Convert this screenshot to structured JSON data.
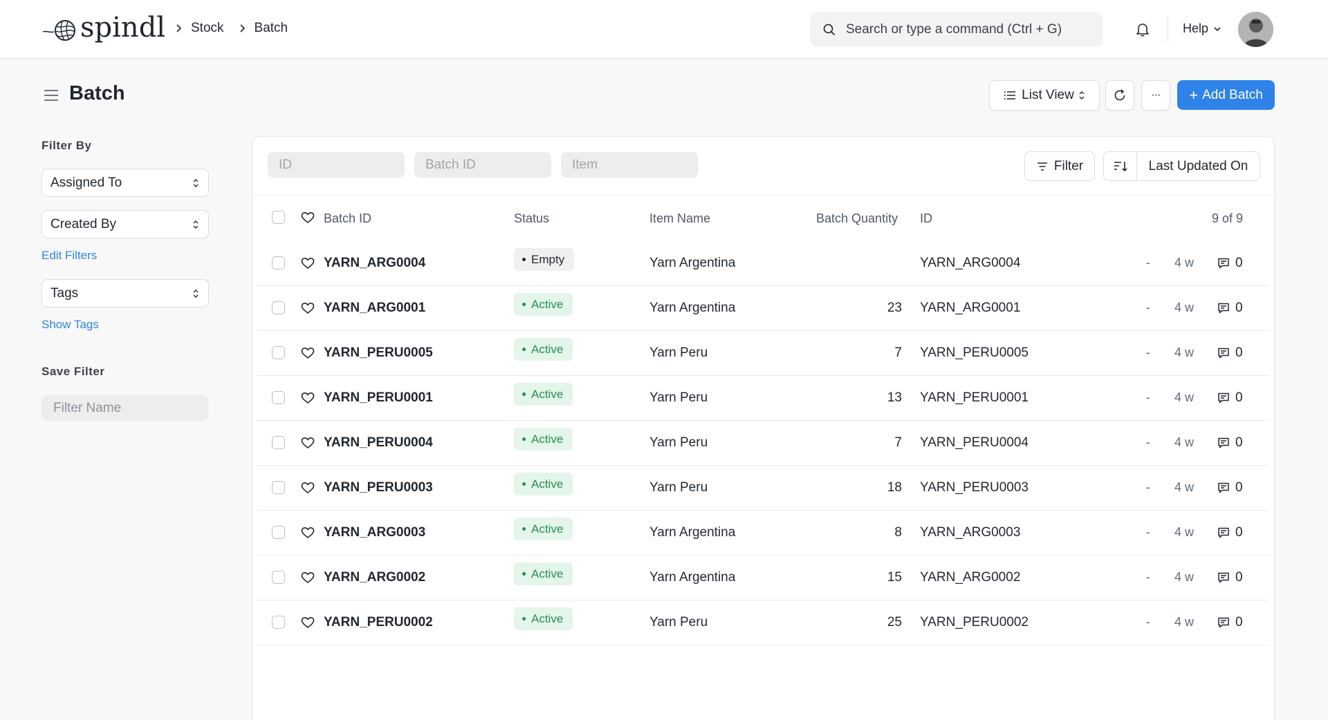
{
  "brand": {
    "name": "spindl"
  },
  "breadcrumbs": [
    "Stock",
    "Batch"
  ],
  "search": {
    "placeholder": "Search or type a command (Ctrl + G)"
  },
  "navbar": {
    "help_label": "Help"
  },
  "page": {
    "title": "Batch",
    "view_label": "List View",
    "add_label": "Add Batch",
    "more_label": "···"
  },
  "sidebar": {
    "filter_heading": "Filter By",
    "assigned_to": "Assigned To",
    "created_by": "Created By",
    "edit_filters": "Edit Filters",
    "tags": "Tags",
    "show_tags": "Show Tags",
    "save_filter_heading": "Save Filter",
    "filter_name_placeholder": "Filter Name"
  },
  "list": {
    "filters": {
      "id_placeholder": "ID",
      "batch_id_placeholder": "Batch ID",
      "item_placeholder": "Item"
    },
    "filter_label": "Filter",
    "sort_label": "Last Updated On",
    "columns": {
      "batch_id": "Batch ID",
      "status": "Status",
      "item_name": "Item Name",
      "batch_qty": "Batch Quantity",
      "id": "ID"
    },
    "count": "9 of 9",
    "rows": [
      {
        "batch_id": "YARN_ARG0004",
        "status": "Empty",
        "item_name": "Yarn Argentina",
        "qty": "",
        "id": "YARN_ARG0004",
        "dash": "-",
        "modified": "4 w",
        "comments": "0"
      },
      {
        "batch_id": "YARN_ARG0001",
        "status": "Active",
        "item_name": "Yarn Argentina",
        "qty": "23",
        "id": "YARN_ARG0001",
        "dash": "-",
        "modified": "4 w",
        "comments": "0"
      },
      {
        "batch_id": "YARN_PERU0005",
        "status": "Active",
        "item_name": "Yarn Peru",
        "qty": "7",
        "id": "YARN_PERU0005",
        "dash": "-",
        "modified": "4 w",
        "comments": "0"
      },
      {
        "batch_id": "YARN_PERU0001",
        "status": "Active",
        "item_name": "Yarn Peru",
        "qty": "13",
        "id": "YARN_PERU0001",
        "dash": "-",
        "modified": "4 w",
        "comments": "0"
      },
      {
        "batch_id": "YARN_PERU0004",
        "status": "Active",
        "item_name": "Yarn Peru",
        "qty": "7",
        "id": "YARN_PERU0004",
        "dash": "-",
        "modified": "4 w",
        "comments": "0"
      },
      {
        "batch_id": "YARN_PERU0003",
        "status": "Active",
        "item_name": "Yarn Peru",
        "qty": "18",
        "id": "YARN_PERU0003",
        "dash": "-",
        "modified": "4 w",
        "comments": "0"
      },
      {
        "batch_id": "YARN_ARG0003",
        "status": "Active",
        "item_name": "Yarn Argentina",
        "qty": "8",
        "id": "YARN_ARG0003",
        "dash": "-",
        "modified": "4 w",
        "comments": "0"
      },
      {
        "batch_id": "YARN_ARG0002",
        "status": "Active",
        "item_name": "Yarn Argentina",
        "qty": "15",
        "id": "YARN_ARG0002",
        "dash": "-",
        "modified": "4 w",
        "comments": "0"
      },
      {
        "batch_id": "YARN_PERU0002",
        "status": "Active",
        "item_name": "Yarn Peru",
        "qty": "25",
        "id": "YARN_PERU0002",
        "dash": "-",
        "modified": "4 w",
        "comments": "0"
      }
    ]
  },
  "colors": {
    "primary": "#2f83e8",
    "active_bg": "#e4f5e9",
    "active_text": "#278f4e",
    "text": "#1f272e"
  },
  "icons": [
    "yarn-logo-icon",
    "chevron-right-icon",
    "search-icon",
    "bell-icon",
    "chevron-down-icon",
    "menu-icon",
    "list-icon",
    "refresh-icon",
    "more-icon",
    "plus-icon",
    "select-arrows-icon",
    "filter-icon",
    "sort-icon",
    "heart-icon",
    "comment-icon"
  ]
}
